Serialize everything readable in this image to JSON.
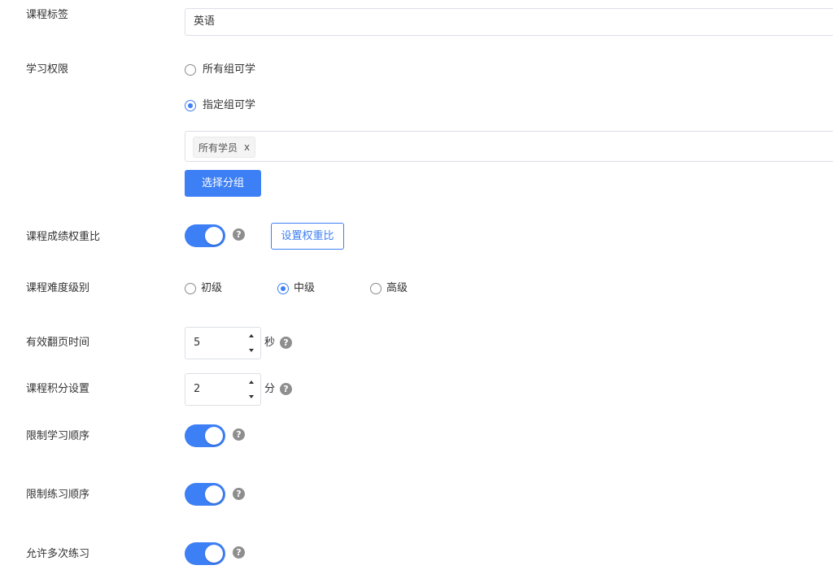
{
  "course_tag": {
    "label": "课程标签",
    "value": "英语"
  },
  "study_permission": {
    "label": "学习权限",
    "options": [
      {
        "label": "所有组可学",
        "checked": false
      },
      {
        "label": "指定组可学",
        "checked": true
      }
    ],
    "selected_groups": [
      {
        "label": "所有学员",
        "close": "x"
      }
    ],
    "select_group_button": "选择分组"
  },
  "score_weight": {
    "label": "课程成绩权重比",
    "enabled": true,
    "help": "?",
    "set_button": "设置权重比"
  },
  "difficulty": {
    "label": "课程难度级别",
    "options": [
      {
        "label": "初级",
        "checked": false
      },
      {
        "label": "中级",
        "checked": true
      },
      {
        "label": "高级",
        "checked": false
      }
    ]
  },
  "page_time": {
    "label": "有效翻页时间",
    "value": "5",
    "unit": "秒",
    "help": "?"
  },
  "points": {
    "label": "课程积分设置",
    "value": "2",
    "unit": "分",
    "help": "?"
  },
  "limit_study_order": {
    "label": "限制学习顺序",
    "enabled": true,
    "help": "?"
  },
  "limit_practice_order": {
    "label": "限制练习顺序",
    "enabled": true,
    "help": "?"
  },
  "allow_multiple_practice": {
    "label": "允许多次练习",
    "enabled": true,
    "help": "?"
  },
  "colors": {
    "accent": "#3d7ff5",
    "help_icon": "#8e8e8e",
    "border": "#dcdfe6"
  }
}
